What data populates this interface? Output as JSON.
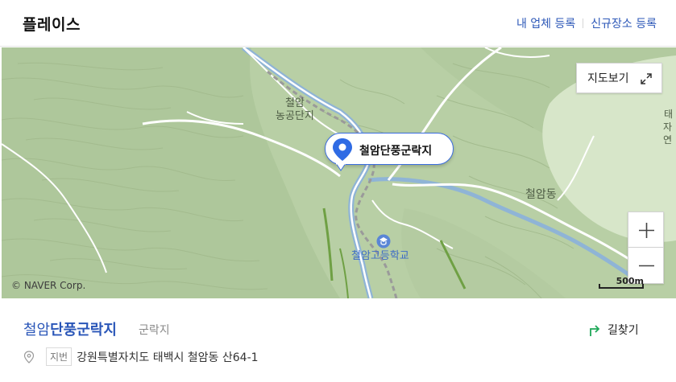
{
  "header": {
    "title": "플레이스",
    "links": [
      "내 업체 등록",
      "신규장소 등록"
    ]
  },
  "map": {
    "view_map_button": "지도보기",
    "copyright": "© NAVER Corp.",
    "scale_label": "500m",
    "zoom_in": "+",
    "zoom_out": "−",
    "labels": {
      "complex": "철암\n농공단지",
      "district": "철암동",
      "school": "철암고등학교",
      "edge_1": "태",
      "edge_2": "자연"
    },
    "marker_label": "철암단풍군락지",
    "accent_color": "#2f6be4"
  },
  "place": {
    "name_prefix": "철암",
    "name_highlight": "단풍군락지",
    "category": "군락지",
    "directions_label": "길찾기",
    "address_badge": "지번",
    "address": "강원특별자치도 태백시 철암동 산64-1"
  }
}
